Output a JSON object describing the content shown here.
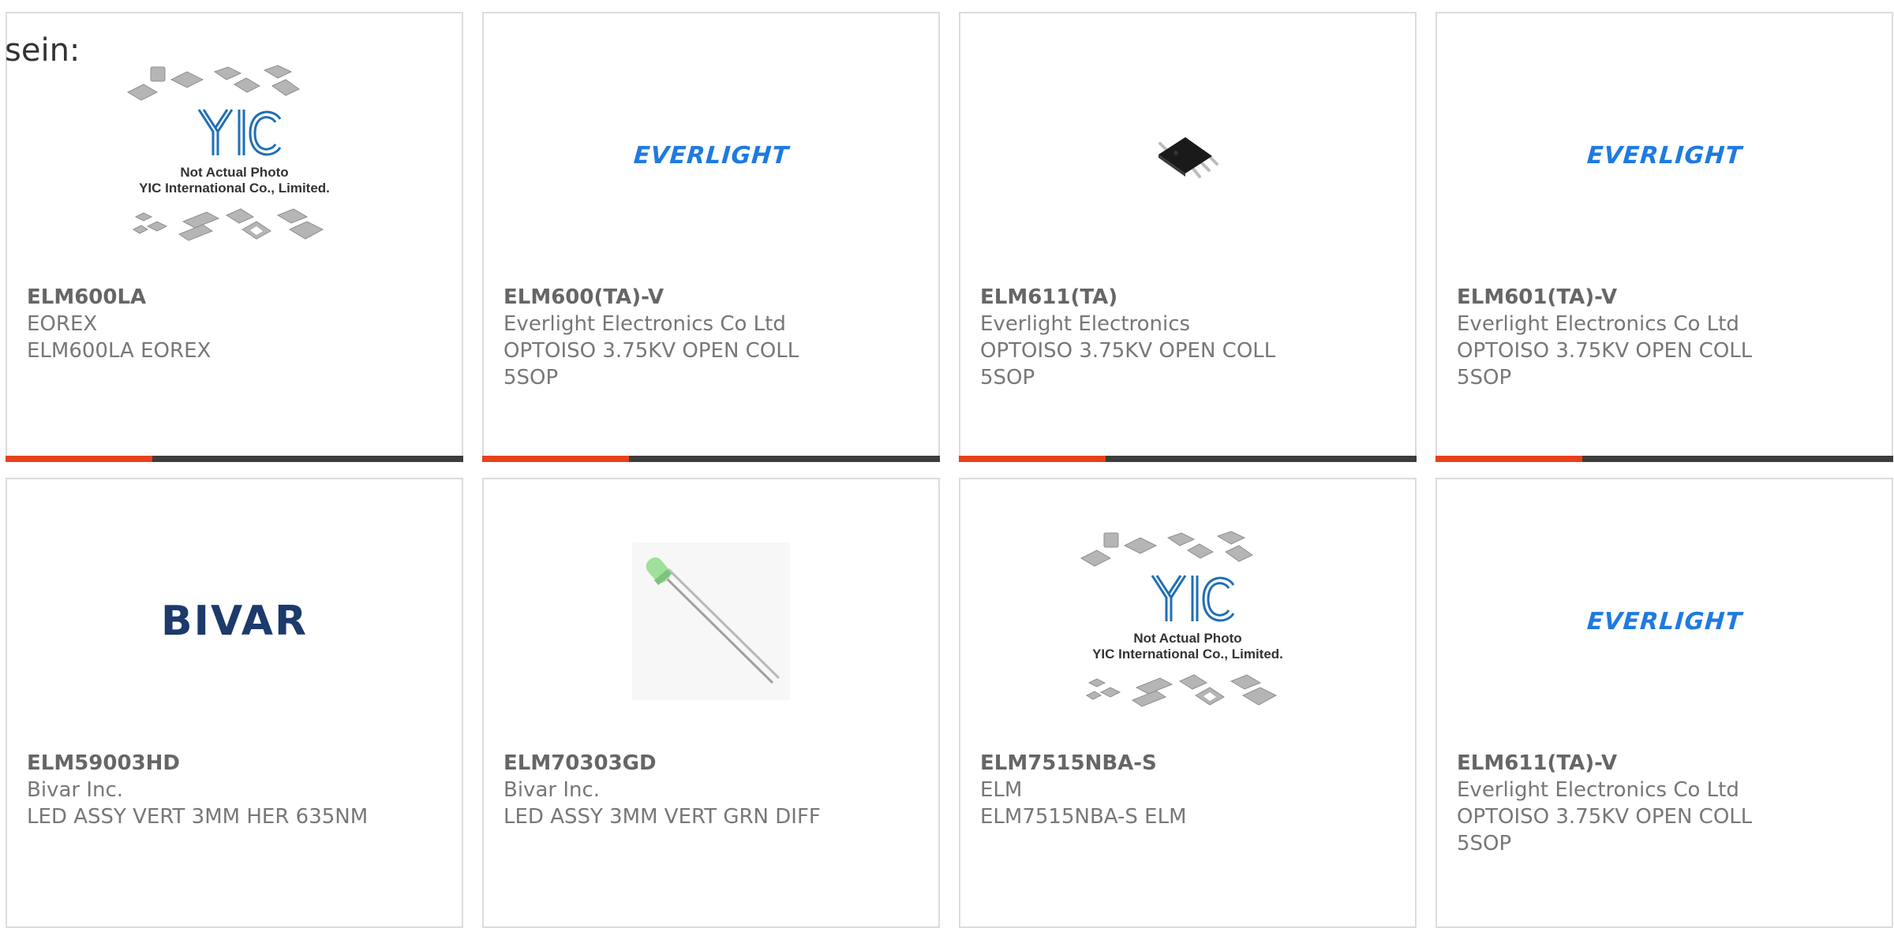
{
  "lead_text": "sein:",
  "colors": {
    "accent": "#e8401c",
    "bar_track": "#3d3d3d",
    "card_border": "#dcdcdc",
    "text": "#666666",
    "everlight_blue": "#1f7ae0",
    "bivar_navy": "#1c3a6b"
  },
  "placeholder_image": {
    "line1": "Not Actual Photo",
    "line2": "YIC International Co., Limited."
  },
  "products": [
    {
      "image": "yic-placeholder",
      "part": "ELM600LA",
      "maker": "EOREX",
      "lines": [
        "ELM600LA EOREX"
      ],
      "progress": 0.32
    },
    {
      "image": "everlight-logo",
      "logo_text": "EVERLIGHT",
      "part": "ELM600(TA)-V",
      "maker": "Everlight Electronics Co Ltd",
      "lines": [
        "OPTOISO 3.75KV OPEN COLL",
        "5SOP"
      ],
      "progress": 0.32
    },
    {
      "image": "sop-chip-photo",
      "part": "ELM611(TA)",
      "maker": "Everlight Electronics",
      "lines": [
        "OPTOISO 3.75KV OPEN COLL",
        "5SOP"
      ],
      "progress": 0.32
    },
    {
      "image": "everlight-logo",
      "logo_text": "EVERLIGHT",
      "part": "ELM601(TA)-V",
      "maker": "Everlight Electronics Co Ltd",
      "lines": [
        "OPTOISO 3.75KV OPEN COLL",
        "5SOP"
      ],
      "progress": 0.32
    },
    {
      "image": "bivar-logo",
      "logo_text": "BIVAR",
      "part": "ELM59003HD",
      "maker": "Bivar Inc.",
      "lines": [
        "LED ASSY VERT 3MM HER 635NM"
      ]
    },
    {
      "image": "green-led-photo",
      "part": "ELM70303GD",
      "maker": "Bivar Inc.",
      "lines": [
        "LED ASSY 3MM VERT GRN DIFF"
      ]
    },
    {
      "image": "yic-placeholder",
      "part": "ELM7515NBA-S",
      "maker": "ELM",
      "lines": [
        "ELM7515NBA-S ELM"
      ]
    },
    {
      "image": "everlight-logo",
      "logo_text": "EVERLIGHT",
      "part": "ELM611(TA)-V",
      "maker": "Everlight Electronics Co Ltd",
      "lines": [
        "OPTOISO 3.75KV OPEN COLL",
        "5SOP"
      ]
    }
  ]
}
